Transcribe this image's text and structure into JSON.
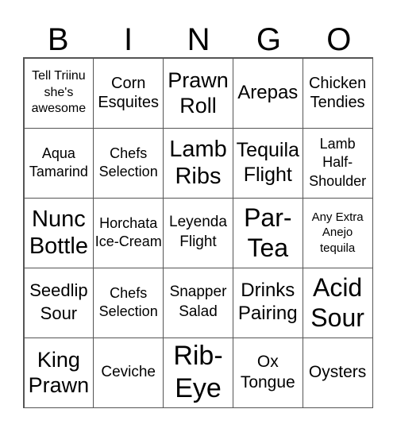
{
  "header": {
    "letters": [
      "B",
      "I",
      "N",
      "G",
      "O"
    ]
  },
  "grid": {
    "cells": [
      "Tell Triinu she's awesome",
      "Corn Esquites",
      "Prawn Roll",
      "Arepas",
      "Chicken Tendies",
      "Aqua Tamarind",
      "Chefs Selection",
      "Lamb Ribs",
      "Tequila Flight",
      "Lamb Half-Shoulder",
      "Nunc Bottle",
      "Horchata Ice-Cream",
      "Leyenda Flight",
      "Par-Tea",
      "Any Extra Anejo tequila",
      "Seedlip Sour",
      "Chefs Selection",
      "Snapper Salad",
      "Drinks Pairing",
      "Acid Sour",
      "King Prawn",
      "Ceviche",
      "Rib-Eye",
      "Ox Tongue",
      "Oysters"
    ]
  }
}
